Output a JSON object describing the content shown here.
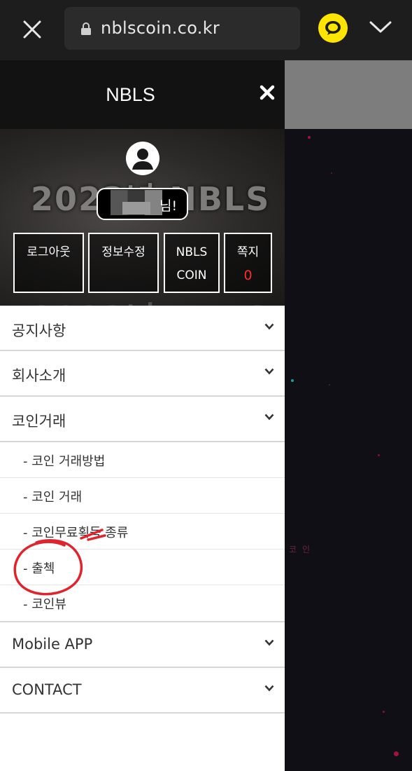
{
  "browser": {
    "url": "nblscoin.co.kr",
    "close_icon": "close-icon",
    "lock_icon": "lock-icon",
    "share_icon": "kakaotalk-icon",
    "menu_icon": "chevron-down-icon",
    "accent_color": "#fee500"
  },
  "panel": {
    "title": "NBLS",
    "close_icon": "close-icon"
  },
  "profile": {
    "banner_text": "2023년 NBLS",
    "greeting_suffix": "님!",
    "buttons": [
      {
        "label": "로그아웃"
      },
      {
        "label": "정보수정"
      },
      {
        "label": "NBLS COIN",
        "line1": "NBLS",
        "line2": "COIN"
      },
      {
        "label": "쪽지",
        "count": "0"
      }
    ]
  },
  "menu": {
    "items": [
      {
        "label": "공지사항"
      },
      {
        "label": "회사소개"
      },
      {
        "label": "코인거래"
      }
    ],
    "submenu": [
      {
        "label": "- 코인 거래방법"
      },
      {
        "label": "- 코인 거래"
      },
      {
        "label": "- 코인무료획득 종류"
      },
      {
        "label": "- 출첵"
      },
      {
        "label": "- 코인뷰"
      }
    ],
    "items_after": [
      {
        "label": "Mobile APP"
      },
      {
        "label": "CONTACT"
      }
    ]
  },
  "background": {
    "side_text": "코인"
  },
  "colors": {
    "menu_header": "#121212",
    "message_count": "#ff2b2b",
    "annotation": "#e0242e"
  }
}
